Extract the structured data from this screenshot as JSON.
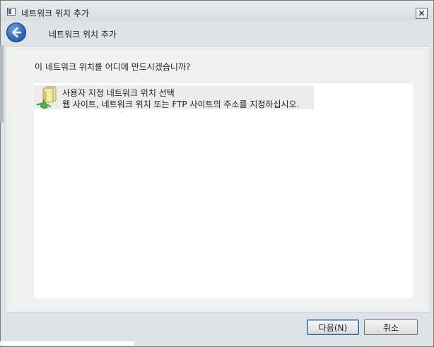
{
  "window": {
    "title": "네트워크 위치 추가",
    "close_label": "✕"
  },
  "wizard": {
    "heading": "네트워크 위치 추가",
    "question": "이 네트워크 위치를 어디에 만드시겠습니까?"
  },
  "list": {
    "items": [
      {
        "title": "사용자 지정 네트워크 위치 선택",
        "description": "웹 사이트, 네트워크 위치 또는 FTP 사이트의 주소를 지정하십시오.",
        "icon": "network-folder-icon"
      }
    ]
  },
  "buttons": {
    "next": "다음(N)",
    "cancel": "취소"
  },
  "colors": {
    "accent": "#2c69b9",
    "window_bg": "#dfe3e8",
    "content_bg": "#f0f0f0",
    "selection": "#ececec"
  }
}
